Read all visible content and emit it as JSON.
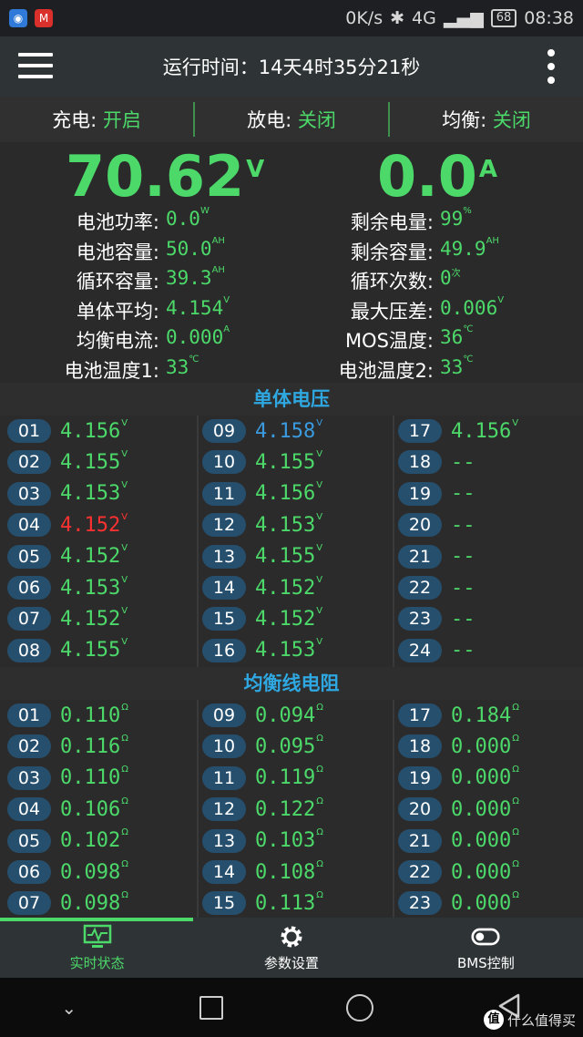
{
  "status_bar": {
    "speed": "0K/s",
    "net": "4G",
    "battery": "68",
    "time": "08:38"
  },
  "header": {
    "title": "运行时间：14天4时35分21秒"
  },
  "switches": [
    {
      "label": "充电:",
      "value": "开启"
    },
    {
      "label": "放电:",
      "value": "关闭"
    },
    {
      "label": "均衡:",
      "value": "关闭"
    }
  ],
  "main": {
    "voltage": "70.62",
    "voltage_unit": "V",
    "current": "0.0",
    "current_unit": "A"
  },
  "stats_left": [
    {
      "label": "电池功率:",
      "value": "0.0",
      "unit": "W"
    },
    {
      "label": "电池容量:",
      "value": "50.0",
      "unit": "AH"
    },
    {
      "label": "循环容量:",
      "value": "39.3",
      "unit": "AH"
    },
    {
      "label": "单体平均:",
      "value": "4.154",
      "unit": "V"
    },
    {
      "label": "均衡电流:",
      "value": "0.000",
      "unit": "A"
    },
    {
      "label": "电池温度1:",
      "value": "33",
      "unit": "℃"
    }
  ],
  "stats_right": [
    {
      "label": "剩余电量:",
      "value": "99",
      "unit": "%"
    },
    {
      "label": "剩余容量:",
      "value": "49.9",
      "unit": "AH"
    },
    {
      "label": "循环次数:",
      "value": "0",
      "unit": "次"
    },
    {
      "label": "最大压差:",
      "value": "0.006",
      "unit": "V"
    },
    {
      "label": "MOS温度:",
      "value": "36",
      "unit": "℃"
    },
    {
      "label": "电池温度2:",
      "value": "33",
      "unit": "℃"
    }
  ],
  "cell_voltage": {
    "title": "单体电压",
    "unit": "V",
    "cells": [
      {
        "id": "01",
        "v": "4.156",
        "s": ""
      },
      {
        "id": "02",
        "v": "4.155",
        "s": ""
      },
      {
        "id": "03",
        "v": "4.153",
        "s": ""
      },
      {
        "id": "04",
        "v": "4.152",
        "s": "red"
      },
      {
        "id": "05",
        "v": "4.152",
        "s": ""
      },
      {
        "id": "06",
        "v": "4.153",
        "s": ""
      },
      {
        "id": "07",
        "v": "4.152",
        "s": ""
      },
      {
        "id": "08",
        "v": "4.155",
        "s": ""
      },
      {
        "id": "09",
        "v": "4.158",
        "s": "blue"
      },
      {
        "id": "10",
        "v": "4.155",
        "s": ""
      },
      {
        "id": "11",
        "v": "4.156",
        "s": ""
      },
      {
        "id": "12",
        "v": "4.153",
        "s": ""
      },
      {
        "id": "13",
        "v": "4.155",
        "s": ""
      },
      {
        "id": "14",
        "v": "4.152",
        "s": ""
      },
      {
        "id": "15",
        "v": "4.152",
        "s": ""
      },
      {
        "id": "16",
        "v": "4.153",
        "s": ""
      },
      {
        "id": "17",
        "v": "4.156",
        "s": ""
      },
      {
        "id": "18",
        "v": "--",
        "s": ""
      },
      {
        "id": "19",
        "v": "--",
        "s": ""
      },
      {
        "id": "20",
        "v": "--",
        "s": ""
      },
      {
        "id": "21",
        "v": "--",
        "s": ""
      },
      {
        "id": "22",
        "v": "--",
        "s": ""
      },
      {
        "id": "23",
        "v": "--",
        "s": ""
      },
      {
        "id": "24",
        "v": "--",
        "s": ""
      }
    ]
  },
  "balance_resistance": {
    "title": "均衡线电阻",
    "unit": "Ω",
    "cells": [
      {
        "id": "01",
        "v": "0.110"
      },
      {
        "id": "02",
        "v": "0.116"
      },
      {
        "id": "03",
        "v": "0.110"
      },
      {
        "id": "04",
        "v": "0.106"
      },
      {
        "id": "05",
        "v": "0.102"
      },
      {
        "id": "06",
        "v": "0.098"
      },
      {
        "id": "07",
        "v": "0.098"
      },
      {
        "id": "09",
        "v": "0.094"
      },
      {
        "id": "10",
        "v": "0.095"
      },
      {
        "id": "11",
        "v": "0.119"
      },
      {
        "id": "12",
        "v": "0.122"
      },
      {
        "id": "13",
        "v": "0.103"
      },
      {
        "id": "14",
        "v": "0.108"
      },
      {
        "id": "15",
        "v": "0.113"
      },
      {
        "id": "17",
        "v": "0.184"
      },
      {
        "id": "18",
        "v": "0.000"
      },
      {
        "id": "19",
        "v": "0.000"
      },
      {
        "id": "20",
        "v": "0.000"
      },
      {
        "id": "21",
        "v": "0.000"
      },
      {
        "id": "22",
        "v": "0.000"
      },
      {
        "id": "23",
        "v": "0.000"
      }
    ]
  },
  "bottom_nav": [
    {
      "label": "实时状态",
      "icon": "monitor-icon",
      "active": true
    },
    {
      "label": "参数设置",
      "icon": "gear-icon",
      "active": false
    },
    {
      "label": "BMS控制",
      "icon": "toggle-icon",
      "active": false
    }
  ],
  "watermark": {
    "text": "什么值得买",
    "badge": "值"
  }
}
